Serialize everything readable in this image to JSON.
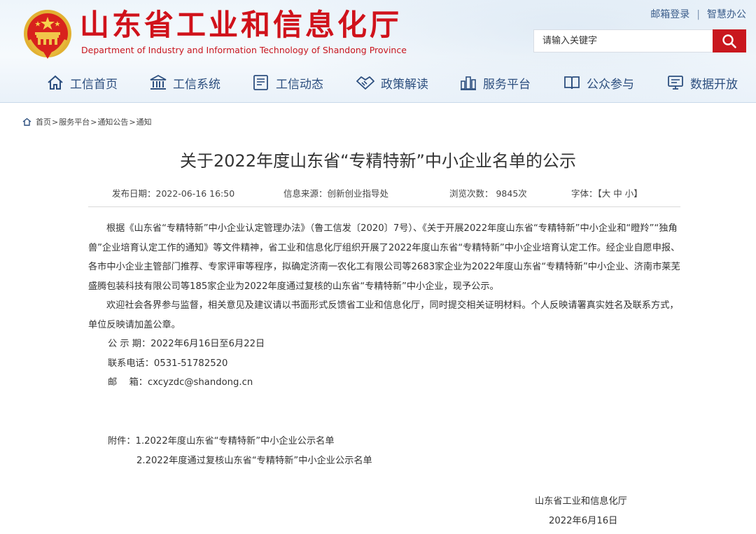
{
  "header": {
    "site_title": "山东省工业和信息化厅",
    "site_subtitle": "Department of Industry and Information Technology of Shandong Province",
    "top_links": [
      "邮箱登录",
      "智慧办公"
    ],
    "search_placeholder": "请输入关键字"
  },
  "nav": {
    "items": [
      {
        "label": "工信首页",
        "icon": "home-icon"
      },
      {
        "label": "工信系统",
        "icon": "building-icon"
      },
      {
        "label": "工信动态",
        "icon": "news-icon"
      },
      {
        "label": "政策解读",
        "icon": "handshake-icon"
      },
      {
        "label": "服务平台",
        "icon": "city-icon"
      },
      {
        "label": "公众参与",
        "icon": "book-icon"
      },
      {
        "label": "数据开放",
        "icon": "monitor-icon"
      }
    ]
  },
  "breadcrumb": [
    "首页",
    "服务平台",
    "通知公告",
    "通知"
  ],
  "article": {
    "title": "关于2022年度山东省“专精特新”中小企业名单的公示",
    "meta": {
      "date": "发布日期：2022-06-16 16:50",
      "source": "信息来源：创新创业指导处",
      "views": "浏览次数： 9845次",
      "font_label": "字体：【",
      "font_large": "大",
      "font_medium": "中",
      "font_small": "小",
      "font_end": "】"
    },
    "paragraphs": [
      "根据《山东省“专精特新”中小企业认定管理办法》（鲁工信发〔2020〕7号）、《关于开展2022年度山东省“专精特新”中小企业和“瞪羚”“独角兽”企业培育认定工作的通知》等文件精神，省工业和信息化厅组织开展了2022年度山东省“专精特新”中小企业培育认定工作。经企业自愿申报、各市中小企业主管部门推荐、专家评审等程序，拟确定济南一农化工有限公司等2683家企业为2022年度山东省“专精特新”中小企业、济南市莱芜盛腾包装科技有限公司等185家企业为2022年度通过复核的山东省“专精特新”中小企业，现予公示。",
      "欢迎社会各界参与监督，相关意见及建议请以书面形式反馈省工业和信息化厅，同时提交相关证明材料。个人反映请署真实姓名及联系方式，单位反映请加盖公章。"
    ],
    "period": "公 示 期：2022年6月16日至6月22日",
    "phone": "联系电话：0531-51782520",
    "email": "邮　 箱：cxcyzdc@shandong.cn",
    "attachments": [
      "附件：1.2022年度山东省“专精特新”中小企业公示名单",
      "2.2022年度通过复核山东省“专精特新”中小企业公示名单"
    ],
    "signature": "山东省工业和信息化厅",
    "sign_date": "2022年6月16日"
  },
  "colors": {
    "brand_red": "#d0121b",
    "nav_blue": "#2d4f7f",
    "search_button": "#c9171e"
  }
}
